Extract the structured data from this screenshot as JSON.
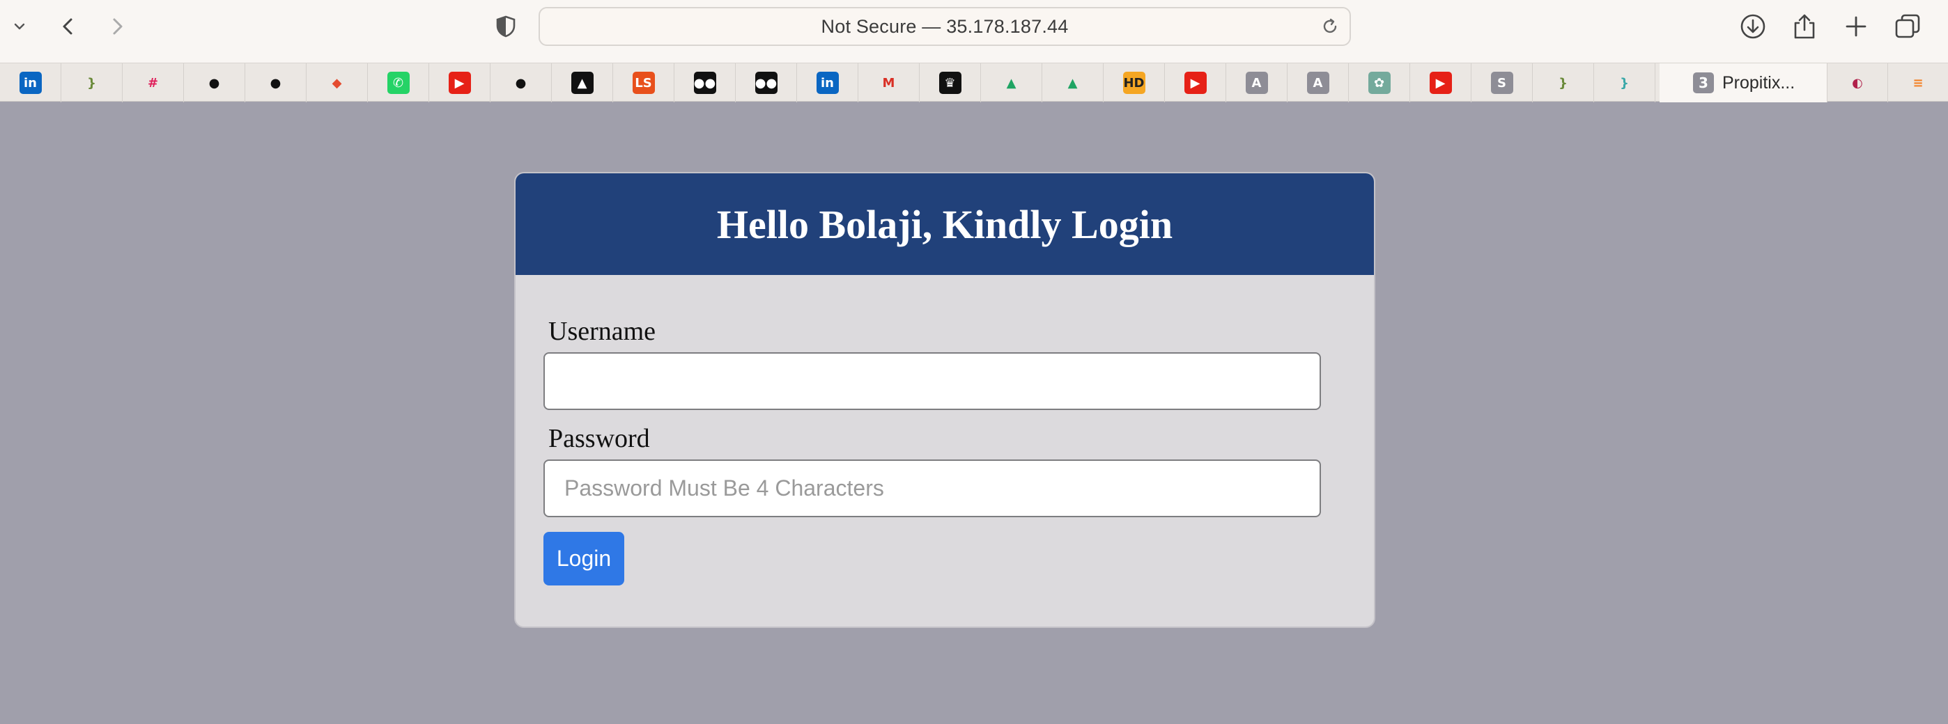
{
  "browser": {
    "address": "Not Secure — 35.178.187.44",
    "icons": [
      "chevron-down-icon",
      "back-icon",
      "forward-icon",
      "shield-icon",
      "reload-icon",
      "downloads-icon",
      "share-icon",
      "new-tab-icon",
      "tab-overview-icon"
    ]
  },
  "tabs": {
    "pinned": [
      {
        "name": "linkedin",
        "glyph": "in",
        "bg": "#0a66c2"
      },
      {
        "name": "brackets",
        "glyph": "}",
        "bg": "transparent",
        "fg": "#6a8a3a"
      },
      {
        "name": "slack",
        "glyph": "#",
        "bg": "transparent",
        "fg": "#e01e5a"
      },
      {
        "name": "github",
        "glyph": "●",
        "bg": "transparent",
        "fg": "#111111"
      },
      {
        "name": "github",
        "glyph": "●",
        "bg": "transparent",
        "fg": "#111111"
      },
      {
        "name": "git",
        "glyph": "◆",
        "bg": "transparent",
        "fg": "#e44c30"
      },
      {
        "name": "whatsapp",
        "glyph": "✆",
        "bg": "#25d366"
      },
      {
        "name": "youtube",
        "glyph": "▶",
        "bg": "#e62117"
      },
      {
        "name": "github",
        "glyph": "●",
        "bg": "transparent",
        "fg": "#111111"
      },
      {
        "name": "mountain",
        "glyph": "▲",
        "bg": "#111111"
      },
      {
        "name": "ls",
        "glyph": "LS",
        "bg": "#e8501c"
      },
      {
        "name": "medium",
        "glyph": "●●",
        "bg": "#111111"
      },
      {
        "name": "medium",
        "glyph": "●●",
        "bg": "#111111"
      },
      {
        "name": "linkedin",
        "glyph": "in",
        "bg": "#0a66c2"
      },
      {
        "name": "gmail",
        "glyph": "M",
        "bg": "transparent",
        "fg": "#d93025"
      },
      {
        "name": "crown",
        "glyph": "♛",
        "bg": "#111111"
      },
      {
        "name": "google-drive",
        "glyph": "▲",
        "bg": "transparent",
        "fg": "#1fa463"
      },
      {
        "name": "google-drive",
        "glyph": "▲",
        "bg": "transparent",
        "fg": "#1fa463"
      },
      {
        "name": "hd",
        "glyph": "HD",
        "bg": "#f5a623",
        "fg": "#222222"
      },
      {
        "name": "youtube",
        "glyph": "▶",
        "bg": "#e62117"
      },
      {
        "name": "a-letter",
        "glyph": "A",
        "bg": "#8e8d96"
      },
      {
        "name": "a-letter",
        "glyph": "A",
        "bg": "#8e8d96"
      },
      {
        "name": "chatgpt",
        "glyph": "✿",
        "bg": "#74aa9c"
      },
      {
        "name": "youtube",
        "glyph": "▶",
        "bg": "#e62117"
      },
      {
        "name": "s-letter",
        "glyph": "S",
        "bg": "#8e8d96"
      },
      {
        "name": "brackets",
        "glyph": "}",
        "bg": "transparent",
        "fg": "#6a8a3a"
      },
      {
        "name": "brackets",
        "glyph": "}",
        "bg": "transparent",
        "fg": "#3aa8a8"
      }
    ],
    "active": {
      "badge": "3",
      "label": "Propitix..."
    },
    "trailing": [
      {
        "name": "app",
        "glyph": "◐",
        "bg": "transparent",
        "fg": "#b0204a"
      },
      {
        "name": "stackoverflow",
        "glyph": "≡",
        "bg": "transparent",
        "fg": "#f48024"
      }
    ]
  },
  "login": {
    "title": "Hello Bolaji, Kindly Login",
    "username_label": "Username",
    "username_value": "",
    "password_label": "Password",
    "password_placeholder": "Password Must Be 4 Characters",
    "button_label": "Login"
  },
  "colors": {
    "page_bg": "#a09fab",
    "header_bg": "#21417a",
    "card_bg": "#dcdadd",
    "button_bg": "#2f78e6"
  }
}
